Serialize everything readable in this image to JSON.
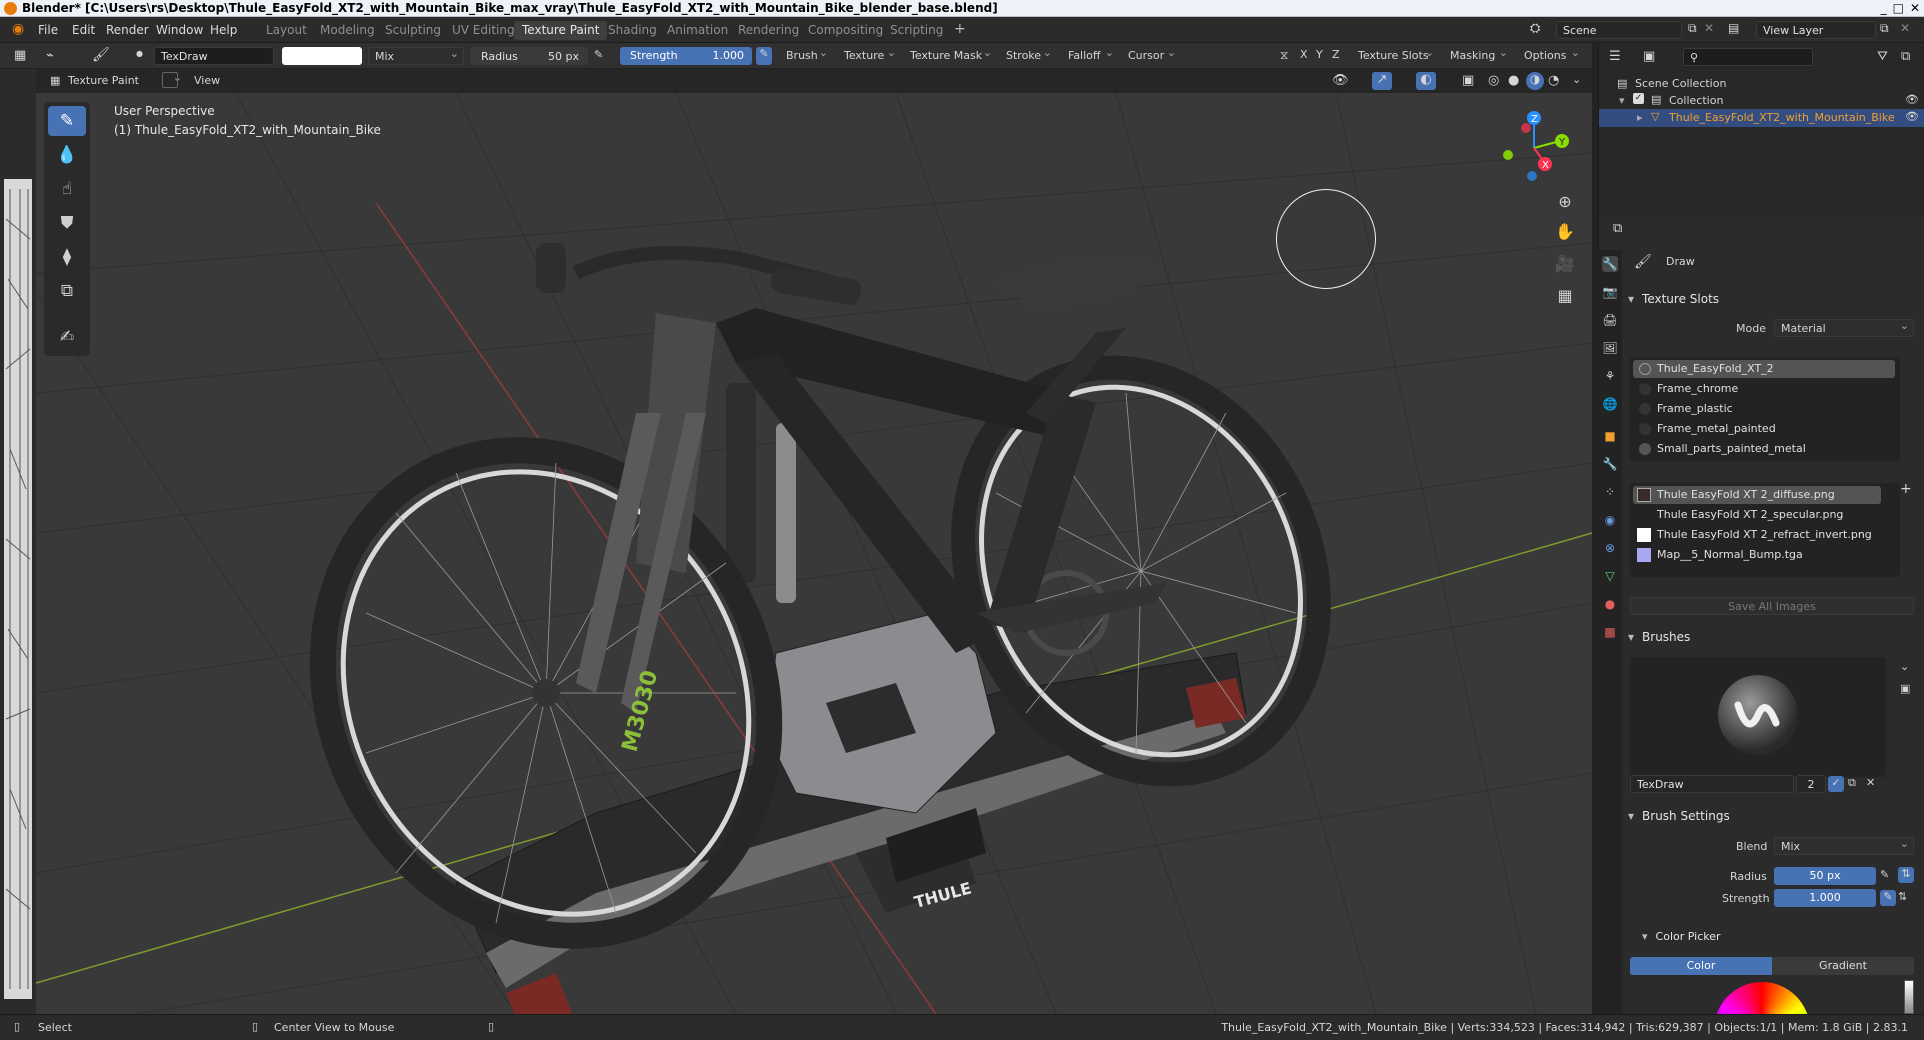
{
  "window": {
    "title": "Blender* [C:\\Users\\rs\\Desktop\\Thule_EasyFold_XT2_with_Mountain_Bike_max_vray\\Thule_EasyFold_XT2_with_Mountain_Bike_blender_base.blend]",
    "controls": [
      "_",
      "□",
      "✕"
    ]
  },
  "menu": {
    "items": [
      "File",
      "Edit",
      "Render",
      "Window",
      "Help"
    ],
    "workspaces": [
      "Layout",
      "Modeling",
      "Sculpting",
      "UV Editing",
      "Texture Paint",
      "Shading",
      "Animation",
      "Rendering",
      "Compositing",
      "Scripting"
    ],
    "active_workspace": "Texture Paint",
    "add_workspace": "+",
    "scene_label": "Scene",
    "view_layer_label": "View Layer"
  },
  "tool_header": {
    "brush_name": "TexDraw",
    "blend_mode": "Mix",
    "radius_label": "Radius",
    "radius_value": "50 px",
    "strength_label": "Strength",
    "strength_value": "1.000",
    "menus": [
      "Brush",
      "Texture",
      "Texture Mask",
      "Stroke",
      "Falloff",
      "Cursor"
    ],
    "axes": [
      "X",
      "Y",
      "Z"
    ],
    "right_menus": [
      "Texture Slots",
      "Masking",
      "Options"
    ]
  },
  "viewport_header": {
    "mode": "Texture Paint",
    "view_menu": "View"
  },
  "viewport": {
    "perspective_label": "User Perspective",
    "object_label": "(1) Thule_EasyFold_XT2_with_Mountain_Bike",
    "fork_text": "M3030",
    "carrier_brand": "THULE",
    "gizmo_axes": [
      "X",
      "Y",
      "Z"
    ]
  },
  "toolbar": {
    "tools": [
      "draw-brush",
      "soften-brush",
      "smear-brush",
      "clone-brush",
      "fill-brush",
      "mask-brush",
      "annotate"
    ]
  },
  "outliner": {
    "root": "Scene Collection",
    "collection": "Collection",
    "object": "Thule_EasyFold_XT2_with_Mountain_Bike"
  },
  "properties": {
    "tool_name": "Draw",
    "texture_slots_title": "Texture Slots",
    "mode_label": "Mode",
    "mode_value": "Material",
    "materials": [
      "Thule_EasyFold_XT_2",
      "Frame_chrome",
      "Frame_plastic",
      "Frame_metal_painted",
      "Small_parts_painted_metal"
    ],
    "images": [
      "Thule EasyFold XT 2_diffuse.png",
      "Thule EasyFold XT 2_specular.png",
      "Thule EasyFold XT 2_refract_invert.png",
      "Map__5_Normal_Bump.tga"
    ],
    "save_all_images": "Save All Images",
    "brushes_title": "Brushes",
    "brush_name": "TexDraw",
    "brush_users": "2",
    "brush_settings_title": "Brush Settings",
    "blend_label": "Blend",
    "blend_value": "Mix",
    "radius_label": "Radius",
    "radius_value": "50 px",
    "strength_label": "Strength",
    "strength_value": "1.000",
    "color_picker_title": "Color Picker",
    "color_tab": "Color",
    "gradient_tab": "Gradient",
    "add_slot": "+"
  },
  "statusbar": {
    "left_action": "Select",
    "middle_action": "Center View to Mouse",
    "stats": "Thule_EasyFold_XT2_with_Mountain_Bike | Verts:334,523 | Faces:314,942 | Tris:629,387 | Objects:1/1 | Mem: 1.8 GiB | 2.83.1"
  },
  "colors": {
    "accent": "#4772b3",
    "selection_orange": "#f0a030",
    "axis_red": "#ff3352",
    "axis_green": "#8bdc00",
    "axis_blue": "#2890ff"
  }
}
